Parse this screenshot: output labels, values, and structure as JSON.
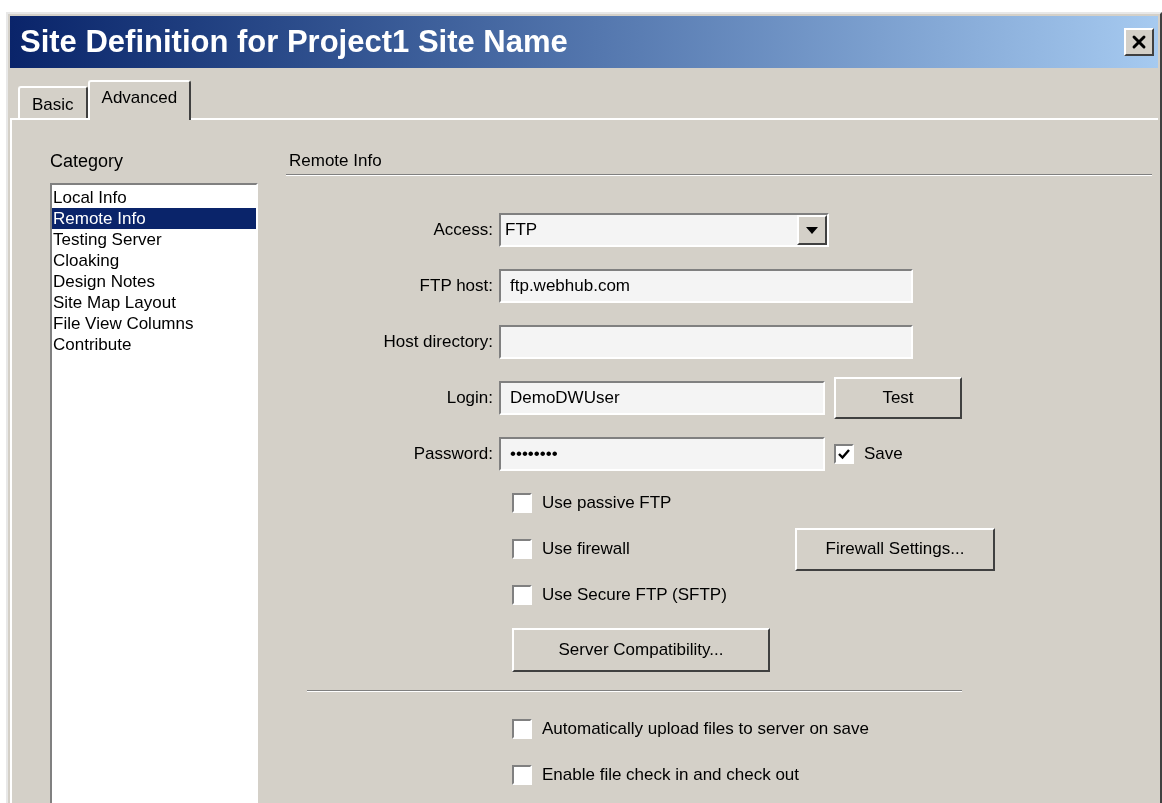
{
  "window": {
    "title": "Site Definition for Project1 Site Name"
  },
  "tabs": [
    {
      "label": "Basic",
      "selected": false
    },
    {
      "label": "Advanced",
      "selected": true
    }
  ],
  "category": {
    "label": "Category",
    "items": [
      {
        "label": "Local Info",
        "selected": false
      },
      {
        "label": "Remote Info",
        "selected": true
      },
      {
        "label": "Testing Server",
        "selected": false
      },
      {
        "label": "Cloaking",
        "selected": false
      },
      {
        "label": "Design Notes",
        "selected": false
      },
      {
        "label": "Site Map Layout",
        "selected": false
      },
      {
        "label": "File View Columns",
        "selected": false
      },
      {
        "label": "Contribute",
        "selected": false
      }
    ]
  },
  "section": {
    "title": "Remote Info"
  },
  "fields": [
    {
      "kind": "select",
      "label": "Access:",
      "value": "FTP"
    },
    {
      "kind": "text",
      "label": "FTP host:",
      "value": "ftp.webhub.com"
    },
    {
      "kind": "text",
      "label": "Host directory:"
    },
    {
      "kind": "text",
      "label": "Login:",
      "value": "DemoDWUser",
      "button": {
        "label": "Test"
      }
    },
    {
      "kind": "text",
      "label": "Password:",
      "value": "••••••••",
      "checkbox": {
        "label": "Save",
        "checked": true
      }
    }
  ],
  "options": [
    {
      "label": "Use passive FTP",
      "checked": false
    },
    {
      "label": "Use firewall",
      "checked": false
    },
    {
      "label": "Use Secure FTP (SFTP)",
      "checked": false
    }
  ],
  "firewall_button": {
    "label": "Firewall Settings..."
  },
  "compatibility_button": {
    "label": "Server Compatibility..."
  },
  "bottom_options": [
    {
      "label": "Automatically upload files to server on save",
      "checked": false
    },
    {
      "label": "Enable file check in and check out",
      "checked": false
    }
  ]
}
